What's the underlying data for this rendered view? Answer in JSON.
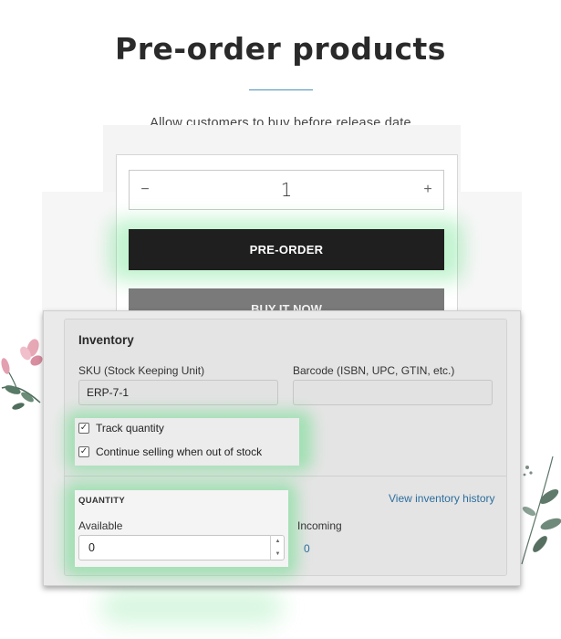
{
  "header": {
    "title": "Pre-order products",
    "subtitle": "Allow customers to buy before release date"
  },
  "product_form": {
    "quantity": {
      "decrement_symbol": "−",
      "value": "1",
      "increment_symbol": "+"
    },
    "preorder_button": "PRE-ORDER",
    "buy_now_button": "BUY IT NOW"
  },
  "inventory": {
    "title": "Inventory",
    "sku": {
      "label": "SKU (Stock Keeping Unit)",
      "value": "ERP-7-1"
    },
    "barcode": {
      "label": "Barcode (ISBN, UPC, GTIN, etc.)",
      "value": ""
    },
    "checkboxes": [
      {
        "label": "Track quantity",
        "checked": true
      },
      {
        "label": "Continue selling when out of stock",
        "checked": true
      }
    ],
    "quantity_section": {
      "heading": "QUANTITY",
      "history_link": "View inventory history",
      "available_label": "Available",
      "available_value": "0",
      "incoming_label": "Incoming",
      "incoming_value": "0"
    }
  },
  "colors": {
    "accent_link": "#2c6e9e",
    "preorder_button_bg": "#1f1f1f",
    "buy_now_button_bg": "#7a7a7a",
    "highlight_glow": "#50dc78"
  }
}
